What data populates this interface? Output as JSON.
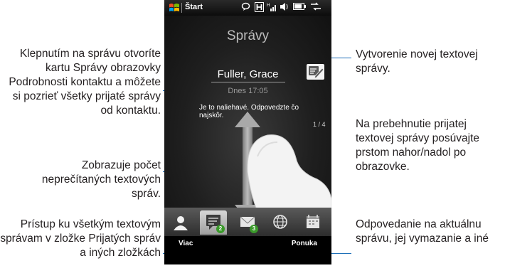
{
  "status_bar": {
    "start_label": "Štart",
    "icons": [
      "windows-logo-icon",
      "chat-icon",
      "h-data-icon",
      "signal-icon",
      "volume-icon",
      "battery-icon",
      "connectivity-icon"
    ]
  },
  "screen": {
    "title": "Správy",
    "contact_name": "Fuller, Grace",
    "message_date": "Dnes 17:05",
    "message_text": "Je to naliehavé. Odpovedzte čo najskôr.",
    "counter": "1 / 4"
  },
  "tabs": [
    {
      "name": "contacts",
      "icon": "person-icon"
    },
    {
      "name": "messages",
      "icon": "message-icon",
      "badge": "2",
      "active": true
    },
    {
      "name": "email",
      "icon": "envelope-icon",
      "badge": "3"
    },
    {
      "name": "internet",
      "icon": "globe-icon"
    },
    {
      "name": "calendar",
      "icon": "calendar-icon"
    }
  ],
  "softkeys": {
    "left": "Viac",
    "right": "Ponuka"
  },
  "callouts": {
    "open_message": "Klepnutím na správu otvoríte kartu Správy obrazovky Podrobnosti kontaktu a môžete si pozrieť všetky prijaté správy od kontaktu.",
    "unread_count": "Zobrazuje počet neprečítaných textových správ.",
    "inbox_access": "Prístup ku všetkým textovým správam v zložke Prijatých správ a iných zložkách",
    "new_message": "Vytvorenie novej textovej správy.",
    "scroll_messages": "Na prebehnutie prijatej textovej správy posúvajte prstom nahor/nadol po obrazovke.",
    "reply_delete": "Odpovedanie na aktuálnu správu, jej vymazanie a iné"
  },
  "colors": {
    "leader": "#1d6fb8",
    "unread_badge_green": "#3a9a2a",
    "email_badge_green": "#3a9a2a"
  }
}
